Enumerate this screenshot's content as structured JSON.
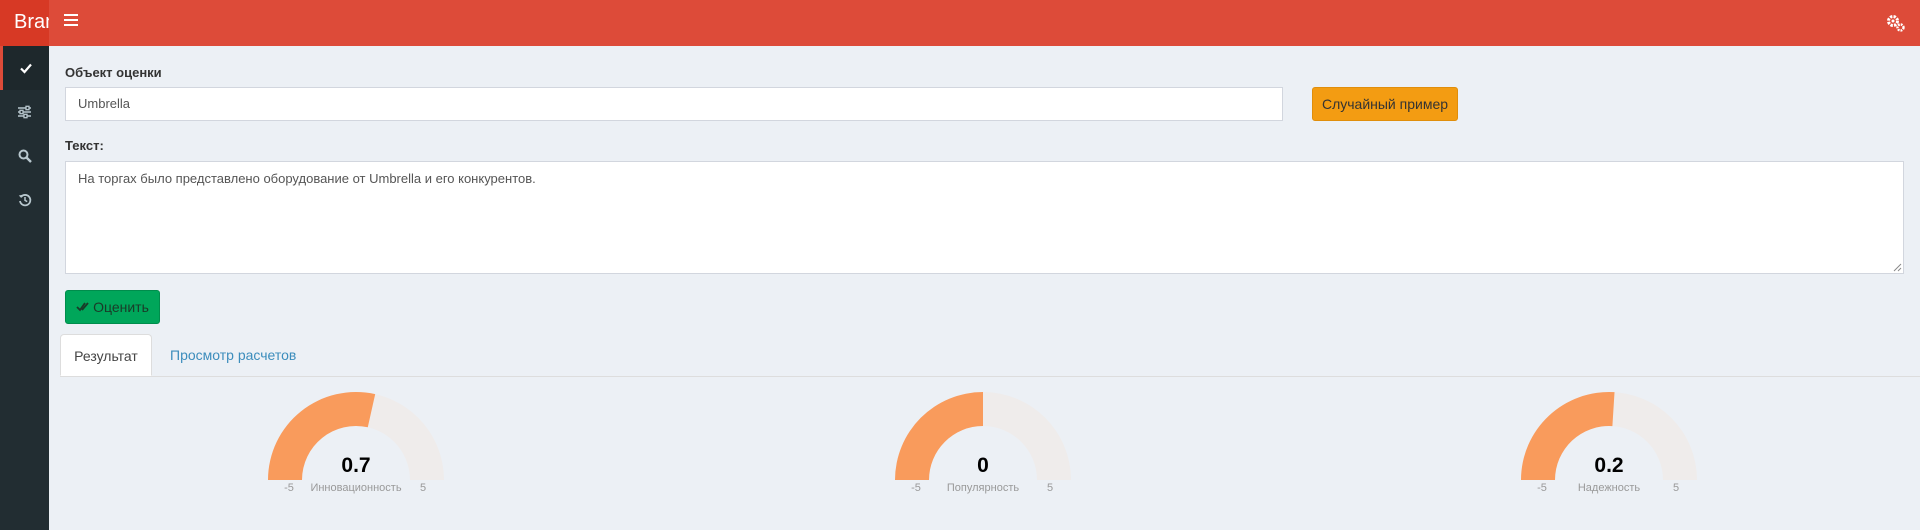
{
  "header": {
    "brand": "Brand"
  },
  "form": {
    "object_label": "Объект оценки",
    "object_value": "Umbrella",
    "random_button": "Случайный пример",
    "text_label": "Текст:",
    "text_value": "На торгах было представлено оборудование от Umbrella и его конкурентов.",
    "evaluate_button": "Оценить"
  },
  "tabs": [
    {
      "label": "Результат"
    },
    {
      "label": "Просмотр расчетов"
    }
  ],
  "colors": {
    "gauge_fill": "#f99b5c",
    "gauge_track": "#efeceb",
    "header": "#dd4b39"
  },
  "gauges": [
    {
      "value": "0.7",
      "num": 0.7,
      "name": "Инновационность",
      "min": "-5",
      "max": "5"
    },
    {
      "value": "0",
      "num": 0,
      "name": "Популярность",
      "min": "-5",
      "max": "5"
    },
    {
      "value": "0.2",
      "num": 0.2,
      "name": "Надежность",
      "min": "-5",
      "max": "5"
    }
  ]
}
